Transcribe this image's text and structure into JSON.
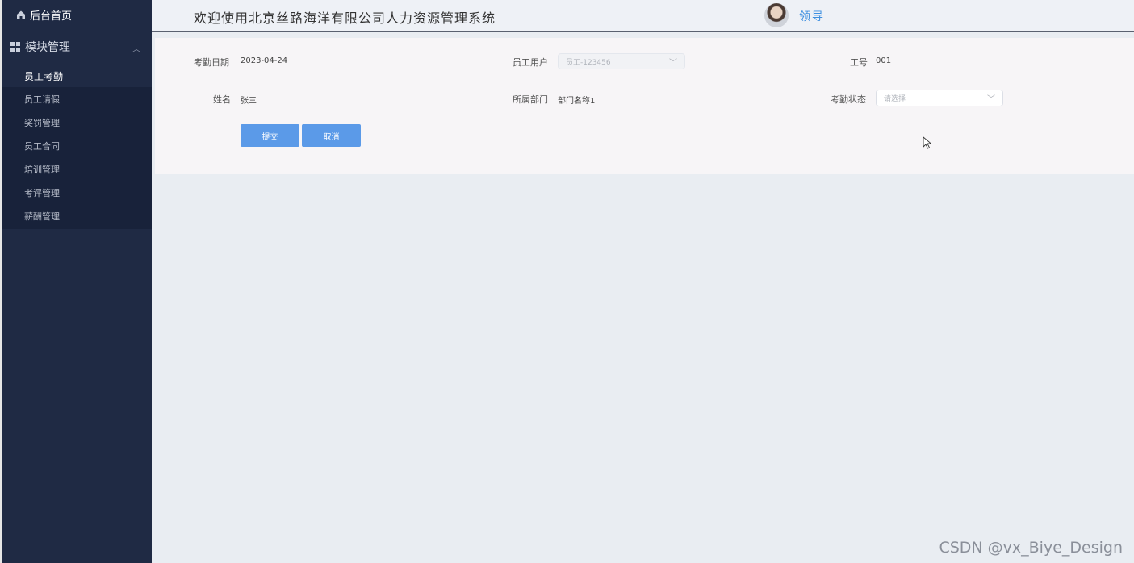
{
  "sidebar": {
    "home_label": "后台首页",
    "module_label": "模块管理",
    "items": [
      {
        "label": "员工考勤",
        "active": true
      },
      {
        "label": "员工请假"
      },
      {
        "label": "奖罚管理"
      },
      {
        "label": "员工合同"
      },
      {
        "label": "培训管理"
      },
      {
        "label": "考评管理"
      },
      {
        "label": "薪酬管理"
      }
    ]
  },
  "header": {
    "title": "欢迎使用北京丝路海洋有限公司人力资源管理系统",
    "user_name": "领导"
  },
  "form": {
    "date_label": "考勤日期",
    "date_value": "2023-04-24",
    "user_label": "员工用户",
    "user_value": "员工-123456",
    "id_label": "工号",
    "id_value": "001",
    "name_label": "姓名",
    "name_value": "张三",
    "dept_label": "所属部门",
    "dept_value": "部门名称1",
    "status_label": "考勤状态",
    "status_placeholder": "请选择",
    "submit_label": "提交",
    "cancel_label": "取消"
  },
  "watermark": "CSDN @vx_Biye_Design",
  "colors": {
    "sidebar_bg": "#1f2a44",
    "submenu_bg": "#18223a",
    "header_bg": "#eef1f6",
    "main_bg": "#e9edf2",
    "accent": "#5b9ae8",
    "user_name": "#3d8fe0"
  },
  "icons": {
    "home": "home-icon",
    "module": "grid-icon",
    "collapse": "chevron-up-icon",
    "select_arrow": "chevron-down-icon"
  }
}
